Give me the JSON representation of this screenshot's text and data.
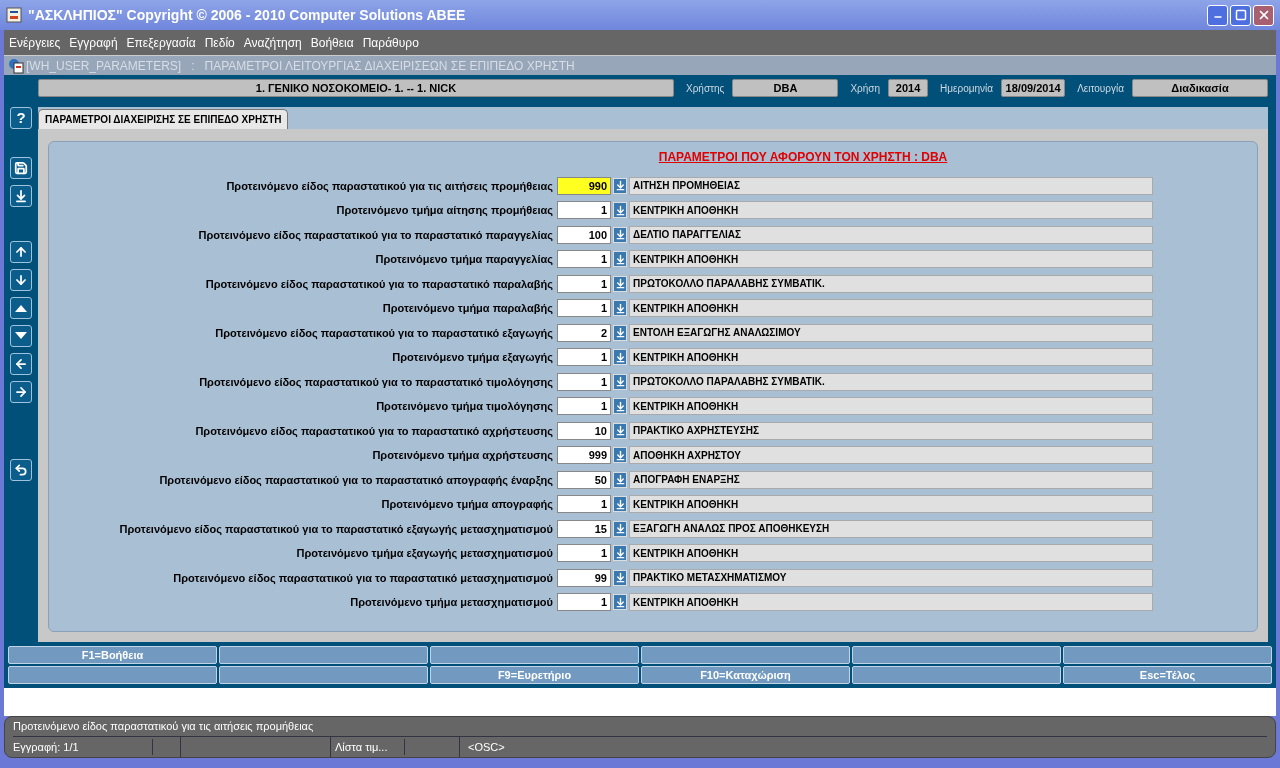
{
  "window": {
    "title": "\"ΑΣΚΛΗΠΙΟΣ\" Copyright © 2006 - 2010 Computer Solutions ABEE"
  },
  "menu": [
    "Ενέργειες",
    "Εγγραφή",
    "Επεξεργασία",
    "Πεδίο",
    "Αναζήτηση",
    "Βοήθεια",
    "Παράθυρο"
  ],
  "form_title": "[WH_USER_PARAMETERS]   :   ΠΑΡΑΜΕΤΡΟΙ ΛΕΙΤΟΥΡΓΙΑΣ ΔΙΑΧΕΙΡΙΣΕΩΝ ΣΕ ΕΠΙΠΕΔΟ ΧΡΗΣΤΗ",
  "header": {
    "organization": "1. ΓΕΝΙΚΟ ΝΟΣΟΚΟΜΕΙΟ- 1. -- 1. NICK",
    "fields": [
      {
        "label": "Χρήστης",
        "value": "DBA"
      },
      {
        "label": "Χρήση",
        "value": "2014"
      },
      {
        "label": "Ημερομηνία",
        "value": "18/09/2014"
      },
      {
        "label": "Λειτουργία",
        "value": "Διαδικασία"
      }
    ]
  },
  "toolbar": {
    "help": "?"
  },
  "tabs": [
    {
      "label": "ΠΑΡΑΜΕΤΡΟΙ ΔΙΑΧΕΙΡΙΣΗΣ ΣΕ ΕΠΙΠΕΔΟ ΧΡΗΣΤΗ",
      "selected": true
    }
  ],
  "section_title": "ΠΑΡΑΜΕΤΡΟΙ ΠΟΥ ΑΦΟΡΟΥΝ ΤΟΝ ΧΡΗΣΤΗ : DBA",
  "rows": [
    {
      "label": "Προτεινόμενο είδος παραστατικού για τις αιτήσεις προμήθειας",
      "code": "990",
      "description": "ΑΙΤΗΣΗ ΠΡΟΜΗΘΕΙΑΣ",
      "focused": true
    },
    {
      "label": "Προτεινόμενο τμήμα αίτησης προμήθειας",
      "code": "1",
      "description": "ΚΕΝΤΡΙΚΗ ΑΠΟΘΗΚΗ",
      "focused": false
    },
    {
      "label": "Προτεινόμενο είδος παραστατικού για το παραστατικό παραγγελίας",
      "code": "100",
      "description": "ΔΕΛΤΙΟ ΠΑΡΑΓΓΕΛΙΑΣ",
      "focused": false
    },
    {
      "label": "Προτεινόμενο τμήμα παραγγελίας",
      "code": "1",
      "description": "ΚΕΝΤΡΙΚΗ ΑΠΟΘΗΚΗ",
      "focused": false
    },
    {
      "label": "Προτεινόμενο είδος παραστατικού για το παραστατικό παραλαβής",
      "code": "1",
      "description": "ΠΡΩΤΟΚΟΛΛΟ ΠΑΡΑΛΑΒΗΣ ΣΥΜΒΑΤΙΚ.",
      "focused": false
    },
    {
      "label": "Προτεινόμενο τμήμα παραλαβής",
      "code": "1",
      "description": "ΚΕΝΤΡΙΚΗ ΑΠΟΘΗΚΗ",
      "focused": false
    },
    {
      "label": "Προτεινόμενο είδος παραστατικού για το παραστατικό εξαγωγής",
      "code": "2",
      "description": "ΕΝΤΟΛΗ ΕΞΑΓΩΓΗΣ ΑΝΑΛΩΣΙΜΟΥ",
      "focused": false
    },
    {
      "label": "Προτεινόμενο τμήμα εξαγωγής",
      "code": "1",
      "description": "ΚΕΝΤΡΙΚΗ ΑΠΟΘΗΚΗ",
      "focused": false
    },
    {
      "label": "Προτεινόμενο είδος παραστατικού για το παραστατικό τιμολόγησης",
      "code": "1",
      "description": "ΠΡΩΤΟΚΟΛΛΟ ΠΑΡΑΛΑΒΗΣ ΣΥΜΒΑΤΙΚ.",
      "focused": false
    },
    {
      "label": "Προτεινόμενο τμήμα τιμολόγησης",
      "code": "1",
      "description": "ΚΕΝΤΡΙΚΗ ΑΠΟΘΗΚΗ",
      "focused": false
    },
    {
      "label": "Προτεινόμενο είδος παραστατικού για το παραστατικό αχρήστευσης",
      "code": "10",
      "description": "ΠΡΑΚΤΙΚΟ ΑΧΡΗΣΤΕΥΣΗΣ",
      "focused": false
    },
    {
      "label": "Προτεινόμενο τμήμα αχρήστευσης",
      "code": "999",
      "description": "ΑΠΟΘΗΚΗ ΑΧΡΗΣΤΟΥ",
      "focused": false
    },
    {
      "label": "Προτεινόμενο είδος παραστατικού για το παραστατικό απογραφής έναρξης",
      "code": "50",
      "description": "ΑΠΟΓΡΑΦΗ ΕΝΑΡΞΗΣ",
      "focused": false
    },
    {
      "label": "Προτεινόμενο τμήμα απογραφής",
      "code": "1",
      "description": "ΚΕΝΤΡΙΚΗ ΑΠΟΘΗΚΗ",
      "focused": false
    },
    {
      "label": "Προτεινόμενο είδος παραστατικού για το παραστατικό εξαγωγής μετασχηματισμού",
      "code": "15",
      "description": "ΕΞΑΓΩΓΗ ΑΝΑΛΩΣ ΠΡΟΣ ΑΠΟΘΗΚΕΥΣΗ",
      "focused": false
    },
    {
      "label": "Προτεινόμενο τμήμα εξαγωγής μετασχηματισμού",
      "code": "1",
      "description": "ΚΕΝΤΡΙΚΗ ΑΠΟΘΗΚΗ",
      "focused": false
    },
    {
      "label": "Προτεινόμενο είδος παραστατικού για το παραστατικό μετασχηματισμού",
      "code": "99",
      "description": "ΠΡΑΚΤΙΚΟ ΜΕΤΑΣΧΗΜΑΤΙΣΜΟΥ",
      "focused": false
    },
    {
      "label": "Προτεινόμενο τμήμα μετασχηματισμού",
      "code": "1",
      "description": "ΚΕΝΤΡΙΚΗ ΑΠΟΘΗΚΗ",
      "focused": false
    }
  ],
  "function_keys": [
    {
      "key_1": "F1=Βοήθεια"
    },
    {
      "key_3": "F9=Ευρετήριο",
      "key_4": "F10=Καταχώριση",
      "key_6": "Esc=Τέλος"
    }
  ],
  "status_bar": {
    "hint": "Προτεινόμενο είδος παραστατικού για τις αιτήσεις προμήθειας",
    "record": "Εγγραφή: 1/1",
    "list": "Λίστα τιμ...",
    "mode": "<OSC>"
  }
}
